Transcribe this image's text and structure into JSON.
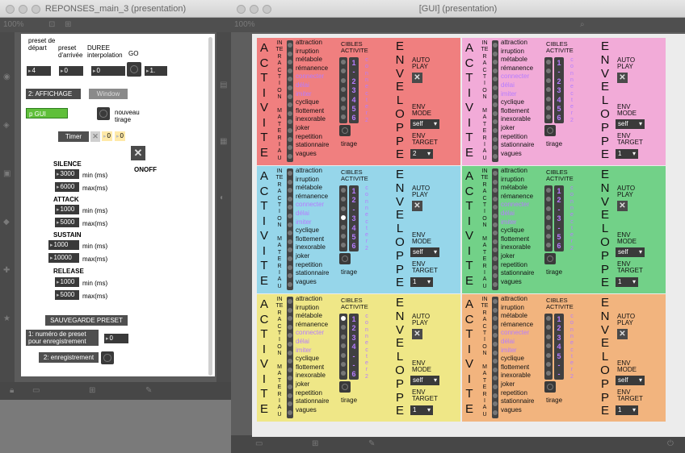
{
  "left_window": {
    "title": "REPONSES_main_3 (presentation)",
    "zoom": "100%",
    "preset_depart_label": "preset de départ",
    "preset_arrivee_label": "preset d'arrivée",
    "duree_label": "DUREE interpolation",
    "go_label": "GO",
    "preset_depart": "4",
    "preset_arrivee": "0",
    "duree": "0",
    "go_value": "1.",
    "affichage_label": "2: AFFICHAGE",
    "window_label": "Window",
    "pgui_label": "p GUI",
    "nouveau_tirage": "nouveau tirage",
    "timer_label": "Timer",
    "timer_val1": "0",
    "timer_val2": "0",
    "onoff_label": "ONOFF",
    "min_label": "min (ms)",
    "max_label": "max(ms)",
    "silence_label": "SILENCE",
    "silence_min": "3000",
    "silence_max": "6000",
    "attack_label": "ATTACK",
    "attack_min": "1000",
    "attack_max": "5000",
    "sustain_label": "SUSTAIN",
    "sustain_min": "1000",
    "sustain_max": "10000",
    "release_label": "RELEASE",
    "release_min": "1000",
    "release_max": "5000",
    "sauvegarde_label": "SAUVEGARDE PRESET",
    "numero_preset_label": "1: numéro de preset pour enregistrement",
    "numero_preset_value": "0",
    "enregistrement_label": "2: enregistrement"
  },
  "right_window": {
    "title": "[GUI] (presentation)",
    "zoom": "100%",
    "activite_letters": [
      "A",
      "C",
      "T",
      "I",
      "V",
      "I",
      "T",
      "E"
    ],
    "interaction_letters": [
      "IN",
      "TE",
      "R",
      "A",
      "C",
      "T",
      "I",
      "O",
      "N",
      "",
      "M",
      "A",
      "T",
      "E",
      "R",
      "I",
      "A",
      "U"
    ],
    "enveloppe_letters": [
      "E",
      "N",
      "V",
      "E",
      "L",
      "O",
      "P",
      "P",
      "E"
    ],
    "connecter_letters": [
      "c",
      "o",
      "n",
      "n",
      "e",
      "c",
      "t",
      "e",
      "r",
      "2"
    ],
    "modes": [
      "attraction",
      "irruption",
      "métabole",
      "rémanence",
      "connecter",
      "délai",
      "imiter",
      "cyclique",
      "flottement",
      "inexorable",
      "joker",
      "repetition",
      "stationnaire",
      "vagues"
    ],
    "cibles_label": "CIBLES ACTIVITE",
    "tirage_label": "tirage",
    "auto_play_label": "AUTO PLAY",
    "env_mode_label": "ENV MODE",
    "env_target_label": "ENV TARGET",
    "env_mode_value": "self",
    "panels": [
      {
        "color": "#f07f7f",
        "digits": [
          "1",
          "-",
          "2",
          "3",
          "4",
          "5",
          "6"
        ],
        "target": "2",
        "selected_mode": -1,
        "selected_digit": -1
      },
      {
        "color": "#f2abd8",
        "digits": [
          "1",
          "-",
          "2",
          "3",
          "4",
          "5",
          "6"
        ],
        "target": "1",
        "selected_mode": -1,
        "selected_digit": -1
      },
      {
        "color": "#96d6ea",
        "digits": [
          "1",
          "2",
          "-",
          "3",
          "4",
          "5",
          "6"
        ],
        "target": "1",
        "selected_mode": -1,
        "selected_digit": 3
      },
      {
        "color": "#72d188",
        "digits": [
          "1",
          "2",
          "-",
          "3",
          "-",
          "5",
          "6"
        ],
        "target": "1",
        "selected_mode": -1,
        "selected_digit": -1
      },
      {
        "color": "#efe787",
        "digits": [
          "1",
          "2",
          "3",
          "4",
          "-",
          "-",
          "6"
        ],
        "target": "1",
        "selected_mode": -1,
        "selected_digit": 0
      },
      {
        "color": "#f2b47e",
        "digits": [
          "1",
          "2",
          "3",
          "4",
          "5",
          "-",
          "-"
        ],
        "target": "1",
        "selected_mode": -1,
        "selected_digit": -1
      }
    ]
  }
}
